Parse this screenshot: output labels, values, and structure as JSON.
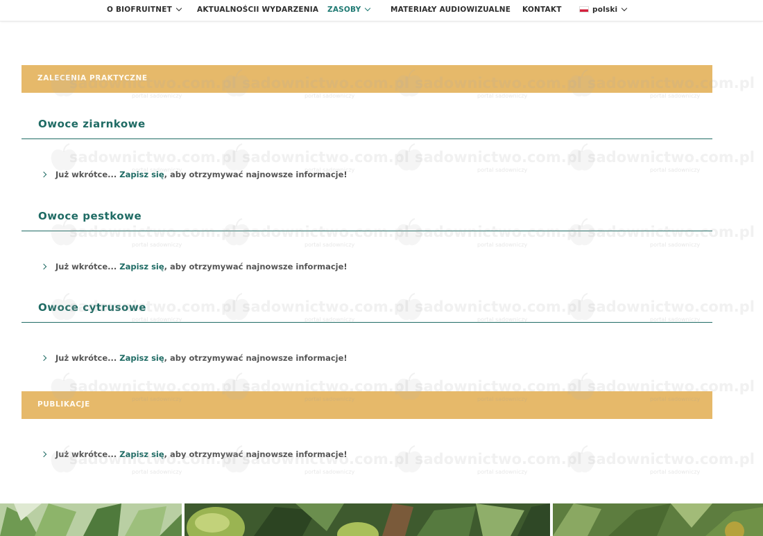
{
  "nav": {
    "items": [
      {
        "label": "O BIOFRUITNET",
        "has_dropdown": true,
        "active": false
      },
      {
        "label": "AKTUALNOŚCII WYDARZENIA",
        "has_dropdown": false,
        "active": false
      },
      {
        "label": "ZASOBY",
        "has_dropdown": true,
        "active": true
      },
      {
        "label": "MATERIAŁY AUDIOWIZUALNE",
        "has_dropdown": false,
        "active": false
      },
      {
        "label": "KONTAKT",
        "has_dropdown": false,
        "active": false
      }
    ],
    "language": "polski",
    "language_flag": "poland-flag-icon"
  },
  "sections": {
    "zalecenia": {
      "title": "ZALECENIA PRAKTYCZNE",
      "categories": [
        {
          "title": "Owoce ziarnkowe",
          "item": {
            "prefix": "Już wkrótce...",
            "link": "Zapisz się",
            "suffix": ", aby otrzymywać najnowsze informacje!"
          }
        },
        {
          "title": "Owoce pestkowe",
          "item": {
            "prefix": "Już wkrótce...",
            "link": "Zapisz się",
            "suffix": ", aby otrzymywać najnowsze informacje!"
          }
        },
        {
          "title": "Owoce cytrusowe",
          "item": {
            "prefix": "Już wkrótce...",
            "link": "Zapisz się",
            "suffix": ", aby otrzymywać najnowsze informacje!"
          }
        }
      ]
    },
    "publikacje": {
      "title": "PUBLIKACJE",
      "item": {
        "prefix": "Już wkrótce...",
        "link": "Zapisz się",
        "suffix": ", aby otrzymywać najnowsze informacje!"
      }
    }
  },
  "watermark": {
    "text": "sadownictwo.com.pl",
    "subtext": "portal sadowniczy"
  },
  "colors": {
    "accent": "#1f6b64",
    "bar": "#e6b96a",
    "nav_active": "#1f7a73"
  }
}
